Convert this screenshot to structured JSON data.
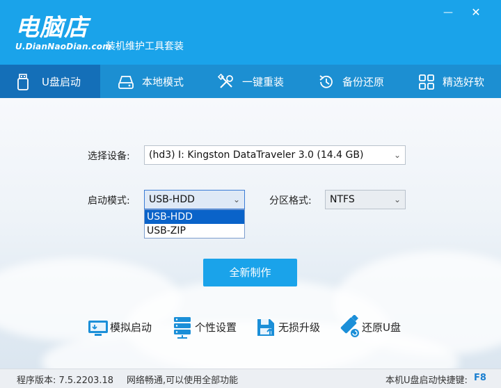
{
  "app": {
    "brand_cn": "电脑店",
    "brand_en": "U.DianNaoDian.com",
    "subtitle": "装机维护工具套装",
    "minimize_glyph": "—",
    "close_glyph": "✕"
  },
  "nav": {
    "items": [
      {
        "label": "U盘启动",
        "icon": "usb-drive-icon",
        "active": true
      },
      {
        "label": "本地模式",
        "icon": "hard-disk-icon",
        "active": false
      },
      {
        "label": "一键重装",
        "icon": "tools-icon",
        "active": false
      },
      {
        "label": "备份还原",
        "icon": "restore-icon",
        "active": false
      },
      {
        "label": "精选好软",
        "icon": "apps-grid-icon",
        "active": false
      }
    ]
  },
  "form": {
    "device_label": "选择设备:",
    "device_value": "(hd3) I: Kingston DataTraveler 3.0 (14.4 GB)",
    "boot_mode_label": "启动模式:",
    "boot_mode_value": "USB-HDD",
    "boot_mode_options": [
      "USB-HDD",
      "USB-ZIP"
    ],
    "partition_label": "分区格式:",
    "partition_value": "NTFS",
    "create_button": "全新制作"
  },
  "tools": [
    {
      "label": "模拟启动",
      "icon": "simulate-boot-icon"
    },
    {
      "label": "个性设置",
      "icon": "server-settings-icon"
    },
    {
      "label": "无损升级",
      "icon": "upgrade-icon"
    },
    {
      "label": "还原U盘",
      "icon": "restore-usb-icon"
    }
  ],
  "status": {
    "version": "程序版本:  7.5.2203.18",
    "network": "网络畅通,可以使用全部功能",
    "hotkey_label": "本机U盘启动快捷键:",
    "hotkey_value": "F8"
  },
  "colors": {
    "title_bg": "#1aa3ea",
    "nav_bg": "#1c8fd2",
    "nav_active": "#146fb8",
    "accent": "#1aa3ea"
  }
}
